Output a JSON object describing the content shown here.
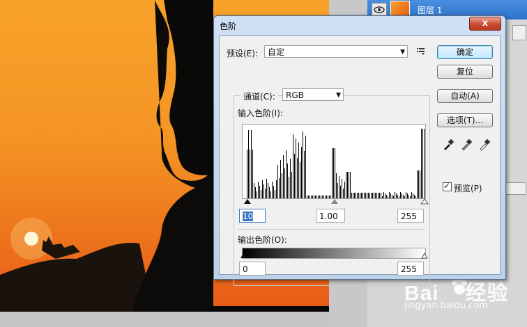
{
  "dialog": {
    "title": "色阶",
    "close_label": "x",
    "preset_label": "预设(E):",
    "preset_value": "自定",
    "channel_label": "通道(C):",
    "channel_value": "RGB",
    "input_label": "输入色阶(I):",
    "input_black": "10",
    "input_gamma": "1.00",
    "input_white": "255",
    "output_label": "输出色阶(O):",
    "output_black": "0",
    "output_white": "255",
    "buttons": {
      "ok": "确定",
      "reset": "复位",
      "auto": "自动(A)",
      "options": "选项(T)..."
    },
    "preview_label": "预览(P)",
    "preview_checked": true
  },
  "layers": {
    "layer_name": "图层 1"
  },
  "watermark": {
    "brand": "Bai",
    "brand_cn": "经验",
    "site": "jingyan.baidu.com"
  }
}
